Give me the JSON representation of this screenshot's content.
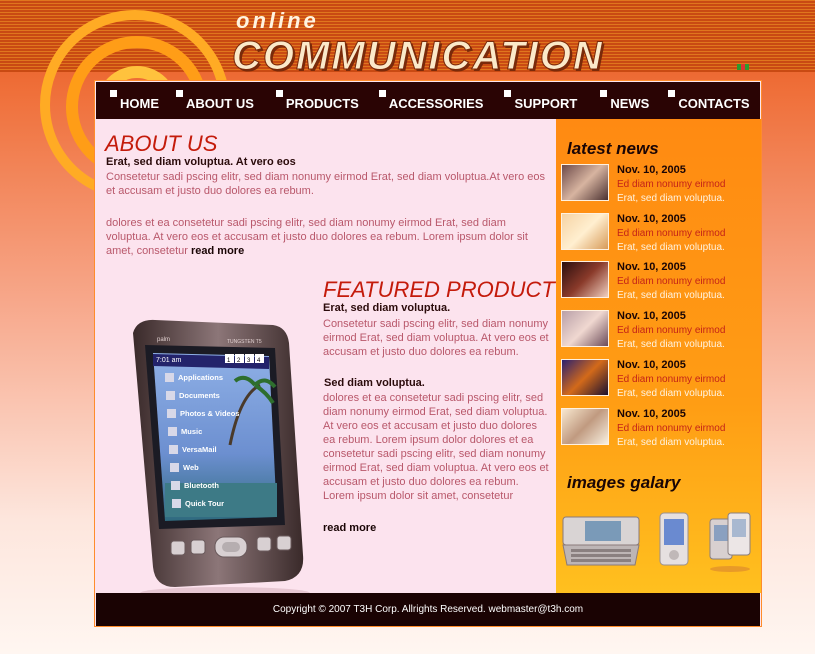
{
  "logo": {
    "top": "online",
    "main": "COMMUNICATION"
  },
  "nav": [
    {
      "label": "HOME"
    },
    {
      "label": "ABOUT US"
    },
    {
      "label": "PRODUCTS"
    },
    {
      "label": "ACCESSORIES"
    },
    {
      "label": "SUPPORT"
    },
    {
      "label": "NEWS"
    },
    {
      "label": "CONTACTS"
    }
  ],
  "about": {
    "title": "ABOUT US",
    "subtitle": "Erat, sed diam voluptua. At vero eos",
    "para1": "Consetetur sadi pscing elitr, sed diam nonumy eirmod Erat, sed diam voluptua.At vero eos et accusam et justo duo dolores ea rebum.",
    "para2": "dolores et ea consetetur sadi pscing elitr, sed diam nonumy eirmod Erat, sed diam voluptua. At vero eos et accusam et justo duo dolores ea rebum. Lorem ipsum dolor sit amet, consetetur",
    "read_more": "read more"
  },
  "featured": {
    "title": "FEATURED PRODUCT",
    "subtitle1": "Erat, sed diam voluptua.",
    "para1": "Consetetur sadi pscing elitr, sed diam nonumy eirmod Erat, sed diam voluptua. At vero eos et accusam et justo duo dolores ea rebum.",
    "subtitle2": "Sed diam voluptua.",
    "para2": "dolores et ea consetetur sadi pscing elitr, sed diam nonumy eirmod Erat, sed diam voluptua. At vero eos et accusam et justo duo dolores ea rebum. Lorem ipsum dolor dolores et ea consetetur sadi pscing elitr, sed diam nonumy eirmod Erat, sed diam voluptua. At vero eos et accusam et justo duo dolores ea rebum. Lorem ipsum dolor sit amet, consetetur",
    "read_more": "read more"
  },
  "device_screen": {
    "time": "7:01 am",
    "tabs": [
      "1",
      "2",
      "3",
      "4"
    ],
    "apps": [
      "Applications",
      "Documents",
      "Photos & Videos",
      "Music",
      "VersaMail",
      "Web",
      "Bluetooth",
      "Quick Tour"
    ],
    "brand": "palm",
    "model": "TUNGSTEN T5"
  },
  "news": {
    "title": "latest news",
    "items": [
      {
        "date": "Nov. 10, 2005",
        "headline": "Ed diam nonumy eirmod",
        "desc": "Erat, sed diam voluptua.",
        "thumb": "city-thumb"
      },
      {
        "date": "Nov. 10, 2005",
        "headline": "Ed diam nonumy eirmod",
        "desc": "Erat, sed diam voluptua.",
        "thumb": "office-thumb"
      },
      {
        "date": "Nov. 10, 2005",
        "headline": "Ed diam nonumy eirmod",
        "desc": "Erat, sed diam voluptua.",
        "thumb": "business-thumb"
      },
      {
        "date": "Nov. 10, 2005",
        "headline": "Ed diam nonumy eirmod",
        "desc": "Erat, sed diam voluptua.",
        "thumb": "headset-thumb"
      },
      {
        "date": "Nov. 10, 2005",
        "headline": "Ed diam nonumy eirmod",
        "desc": "Erat, sed diam voluptua.",
        "thumb": "sunset-thumb"
      },
      {
        "date": "Nov. 10, 2005",
        "headline": "Ed diam nonumy eirmod",
        "desc": "Erat, sed diam voluptua.",
        "thumb": "device-thumb"
      }
    ]
  },
  "gallery": {
    "title": "images galary"
  },
  "footer": {
    "text": "Copyright © 2007 T3H Corp. Allrights Reserved. webmaster@t3h.com"
  },
  "colors": {
    "accent": "#c41b0b",
    "nav_bg": "#2a0404",
    "sidebar": "#ff8a12",
    "text_pink": "#b9586b"
  }
}
